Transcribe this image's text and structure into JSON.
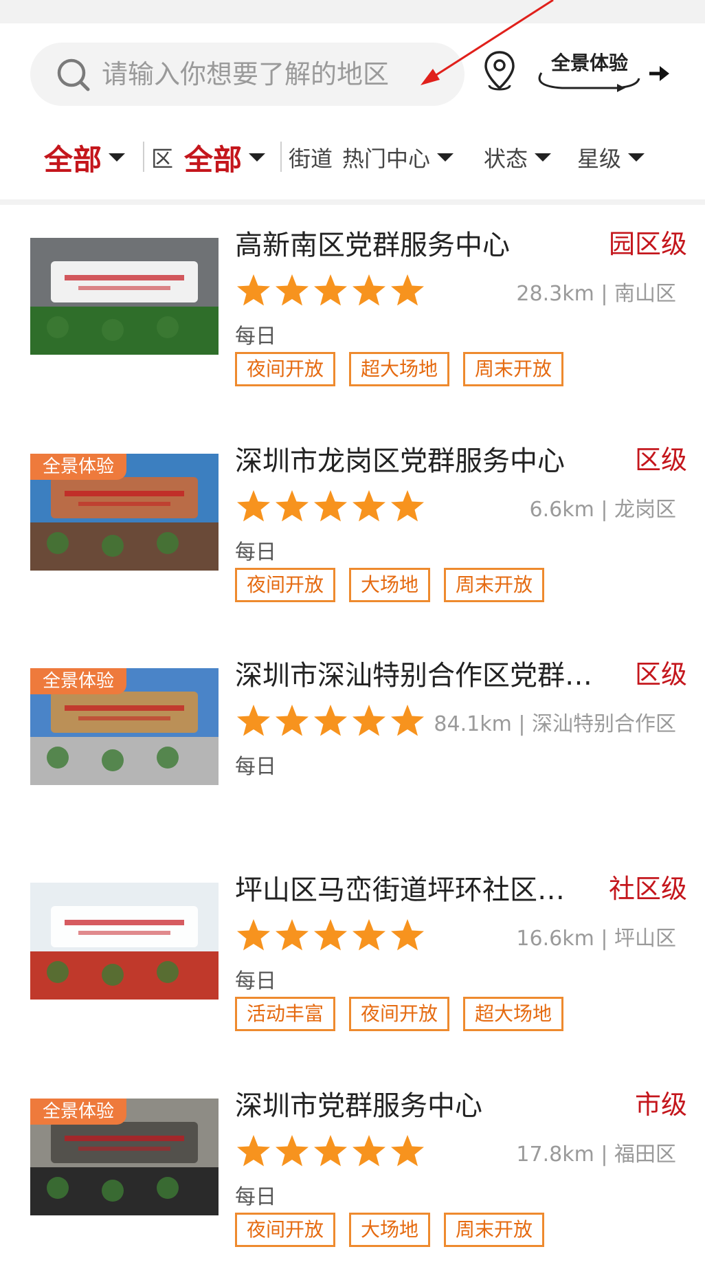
{
  "search": {
    "placeholder": "请输入你想要了解的地区",
    "panorama_label": "全景体验"
  },
  "filters": {
    "city_value": "全部",
    "district_label": "区",
    "district_value": "全部",
    "street_label": "街道",
    "street_value": "热门中心",
    "status_label": "状态",
    "star_label": "星级"
  },
  "colors": {
    "accent_red": "#c4161c",
    "tag_orange": "#ee8a2e",
    "star_orange": "#f7931e",
    "badge_orange": "#ee7a3c"
  },
  "centers": [
    {
      "title": "高新南区党群服务中心",
      "level": "园区级",
      "rating": 5,
      "distance": "28.3km | 南山区",
      "hours": "每日",
      "panorama_badge": "",
      "tags": [
        "夜间开放",
        "超大场地",
        "周末开放"
      ]
    },
    {
      "title": "深圳市龙岗区党群服务中心",
      "level": "区级",
      "rating": 5,
      "distance": "6.6km | 龙岗区",
      "hours": "每日",
      "panorama_badge": "全景体验",
      "tags": [
        "夜间开放",
        "大场地",
        "周末开放"
      ]
    },
    {
      "title": "深圳市深汕特别合作区党群…",
      "level": "区级",
      "rating": 5,
      "distance": "84.1km | 深汕特别合作区",
      "hours": "每日",
      "panorama_badge": "全景体验",
      "tags": []
    },
    {
      "title": "坪山区马峦街道坪环社区…",
      "level": "社区级",
      "rating": 5,
      "distance": "16.6km | 坪山区",
      "hours": "每日",
      "panorama_badge": "",
      "tags": [
        "活动丰富",
        "夜间开放",
        "超大场地"
      ]
    },
    {
      "title": "深圳市党群服务中心",
      "level": "市级",
      "rating": 5,
      "distance": "17.8km | 福田区",
      "hours": "每日",
      "panorama_badge": "全景体验",
      "tags": [
        "夜间开放",
        "大场地",
        "周末开放"
      ]
    }
  ]
}
